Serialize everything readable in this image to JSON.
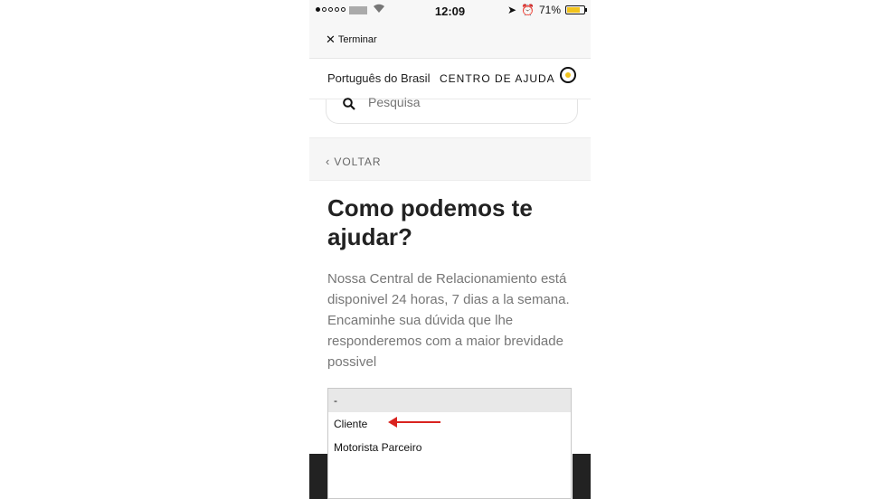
{
  "status": {
    "time": "12:09",
    "battery": "71%",
    "battery_level": 0.71,
    "wifi_icon": "wifi-icon",
    "location_icon": "location-arrow-icon",
    "alarm_icon": "alarm-clock-icon"
  },
  "nav": {
    "close_label": "Terminar"
  },
  "header": {
    "language": "Português do Brasil",
    "help_center": "CENTRO DE AJUDA"
  },
  "search": {
    "placeholder": "Pesquisa"
  },
  "back": {
    "label": "VOLTAR"
  },
  "content": {
    "title": "Como podemos te ajudar?",
    "description": "Nossa Central de Relacionamiento está disponivel 24 horas, 7 dias a la semana. Encaminhe sua dúvida que lhe responderemos com a maior brevidade possivel"
  },
  "select": {
    "options": [
      "-",
      "Cliente",
      "Motorista Parceiro"
    ],
    "selected_index": 0
  },
  "colors": {
    "accent_yellow": "#f2c31b",
    "annotation_red": "#d9231f"
  }
}
